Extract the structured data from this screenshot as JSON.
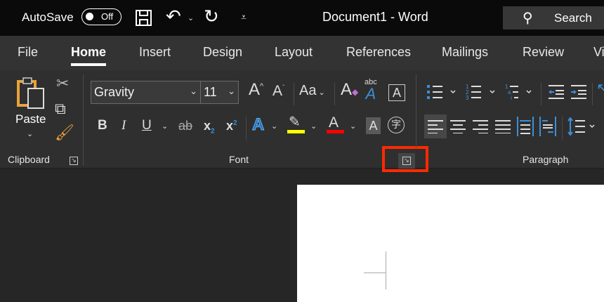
{
  "titlebar": {
    "autosave_label": "AutoSave",
    "autosave_state": "Off",
    "doc_title": "Document1  -  Word",
    "search_placeholder": "Search"
  },
  "tabs": [
    "File",
    "Home",
    "Insert",
    "Design",
    "Layout",
    "References",
    "Mailings",
    "Review",
    "Vi"
  ],
  "active_tab": "Home",
  "clipboard": {
    "paste_label": "Paste",
    "group_label": "Clipboard"
  },
  "font": {
    "font_name": "Gravity",
    "font_size": "11",
    "group_label": "Font",
    "bold": "B",
    "italic": "I",
    "underline": "U",
    "strike": "ab",
    "subscript": "x",
    "superscript": "x",
    "grow": "A",
    "shrink": "A",
    "change_case": "Aa",
    "clear": "A",
    "phonetic": "A",
    "border": "A",
    "effects": "A",
    "highlight_color": "#ffff00",
    "font_color": "#ff0000",
    "shading": "A",
    "enclosed": "字"
  },
  "paragraph": {
    "group_label": "Paragraph"
  },
  "highlight_box_color": "#ff2a00"
}
